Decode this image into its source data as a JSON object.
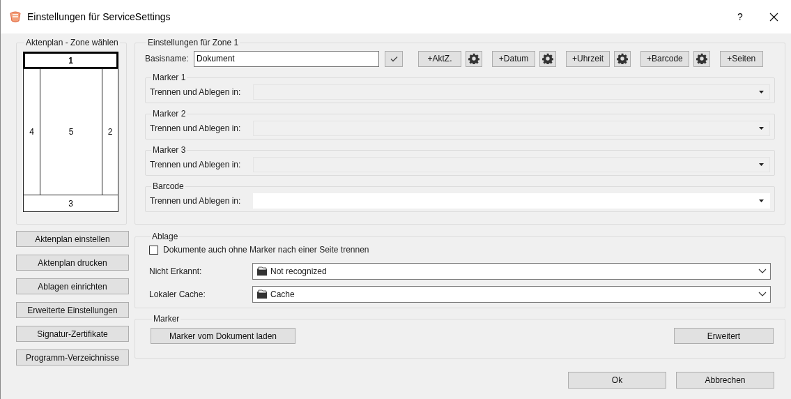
{
  "window": {
    "title": "Einstellungen für ServiceSettings",
    "help": "?"
  },
  "zone_panel": {
    "title": "Aktenplan - Zone wählen",
    "zones": [
      {
        "label": "1",
        "kind": "top",
        "selected": true
      },
      {
        "label": "4",
        "kind": "left",
        "selected": false
      },
      {
        "label": "5",
        "kind": "center",
        "selected": false
      },
      {
        "label": "2",
        "kind": "right",
        "selected": false
      },
      {
        "label": "3",
        "kind": "bottom",
        "selected": false
      }
    ]
  },
  "side_buttons": [
    "Aktenplan einstellen",
    "Aktenplan drucken",
    "Ablagen einrichten",
    "Erweiterte Einstellungen",
    "Signatur-Zertifikate",
    "Programm-Verzeichnisse"
  ],
  "zone_settings": {
    "title": "Einstellungen für Zone 1",
    "basisname": {
      "label": "Basisname:",
      "value": "Dokument"
    },
    "insert_buttons": [
      {
        "label": "+AktZ.",
        "has_settings": true
      },
      {
        "label": "+Datum",
        "has_settings": true
      },
      {
        "label": "+Uhrzeit",
        "has_settings": true
      },
      {
        "label": "+Barcode",
        "has_settings": true
      },
      {
        "label": "+Seiten",
        "has_settings": false
      }
    ],
    "markers": [
      {
        "title": "Marker 1",
        "label": "Trennen und Ablegen in:",
        "disabled": true
      },
      {
        "title": "Marker 2",
        "label": "Trennen und Ablegen in:",
        "disabled": true
      },
      {
        "title": "Marker 3",
        "label": "Trennen und Ablegen in:",
        "disabled": true
      },
      {
        "title": "Barcode",
        "label": "Trennen und Ablegen in:",
        "disabled": false
      }
    ]
  },
  "ablage": {
    "title": "Ablage",
    "checkbox": {
      "label": "Dokumente auch ohne Marker nach einer Seite trennen",
      "checked": false
    },
    "fields": [
      {
        "label": "Nicht Erkannt:",
        "value": "Not recognized"
      },
      {
        "label": "Lokaler Cache:",
        "value": "Cache"
      }
    ]
  },
  "marker_group": {
    "title": "Marker",
    "buttons": [
      "Marker vom Dokument laden",
      "Erweitert"
    ]
  },
  "footer_buttons": [
    "Ok",
    "Abbrechen"
  ]
}
